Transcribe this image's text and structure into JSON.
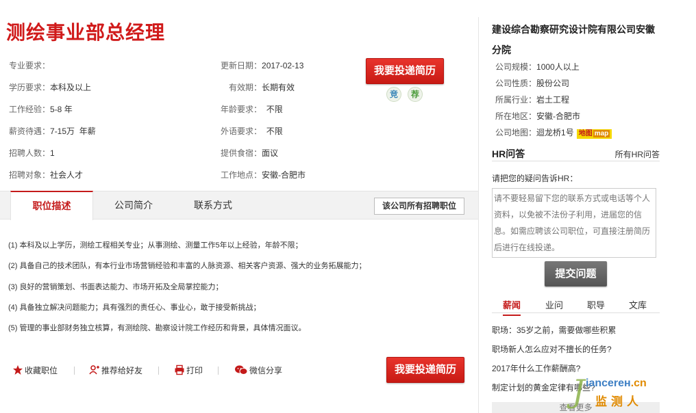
{
  "job": {
    "title": "测绘事业部总经理",
    "fields_left": [
      {
        "key": "专业要求：",
        "value": ""
      },
      {
        "key": "学历要求：",
        "value": "本科及以上"
      },
      {
        "key": "工作经验：",
        "value": "5-8 年"
      },
      {
        "key": "薪资待遇：",
        "value": "7-15万  年薪"
      },
      {
        "key": "招聘人数：",
        "value": "1"
      },
      {
        "key": "招聘对象：",
        "value": "社会人才"
      }
    ],
    "fields_right": [
      {
        "key": "更新日期：",
        "value": "2017-02-13"
      },
      {
        "key": "有效期：",
        "value": "长期有效"
      },
      {
        "key": "年龄要求：",
        "value": "不限"
      },
      {
        "key": "外语要求：",
        "value": "不限"
      },
      {
        "key": "提供食宿：",
        "value": "面议"
      },
      {
        "key": "工作地点：",
        "value": "安徽-合肥市"
      }
    ],
    "apply_label": "我要投递简历",
    "badge_jing": "竞",
    "badge_jian": "荐"
  },
  "tabs": {
    "items": [
      "职位描述",
      "公司简介",
      "联系方式"
    ],
    "all_jobs": "该公司所有招聘职位"
  },
  "description": [
    "(1) 本科及以上学历，测绘工程相关专业；从事测绘、测量工作5年以上经验，年龄不限；",
    "(2) 具备自己的技术团队，有本行业市场营销经验和丰富的人脉资源、相关客户资源、强大的业务拓展能力；",
    "(3) 良好的营销策划、书面表达能力、市场开拓及全局掌控能力；",
    "(4) 具备独立解决问题能力；具有强烈的责任心、事业心，敢于接受新挑战；",
    "(5) 管理的事业部财务独立核算，有测绘院、勘察设计院工作经历和背景，具体情况面议。"
  ],
  "actions": {
    "favorite": "收藏职位",
    "recommend": "推荐给好友",
    "print": "打印",
    "wechat": "微信分享"
  },
  "company": {
    "name": "建设综合勘察研究设计院有限公司安徽分院",
    "info": [
      {
        "key": "公司规模：",
        "value": "1000人以上"
      },
      {
        "key": "公司性质：",
        "value": "股份公司"
      },
      {
        "key": "所属行业：",
        "value": "岩土工程"
      },
      {
        "key": "所在地区：",
        "value": "安徽-合肥市"
      },
      {
        "key": "公司地图：",
        "value": "迴龙桥1号"
      }
    ],
    "map_badge": "地图",
    "map_badge_en": "map"
  },
  "hr": {
    "title": "HR问答",
    "all": "所有HR问答",
    "prompt": "请把您的疑问告诉HR：",
    "placeholder": "请不要轻易留下您的联系方式或电话等个人资料，以免被不法份子利用，进届您的信息。如需应聘该公司职位，可直接注册简历后进行在线投递。",
    "submit": "提交问题"
  },
  "news": {
    "tabs": [
      "薪闻",
      "业问",
      "职导",
      "文库"
    ],
    "items": [
      "职场：35岁之前，需要做哪些积累",
      "职场新人怎么应对不擅长的任务?",
      "2017年什么工作薪酬高?",
      "制定计划的黄金定律有哪些?"
    ],
    "more": "查看更多"
  },
  "watermark": {
    "letter": "J",
    "site": "iancerен",
    "tld": ".cn",
    "label": "监测人"
  },
  "colors": {
    "accent": "#c41a1a",
    "button_red": "#d42620",
    "button_gray": "#666666"
  }
}
